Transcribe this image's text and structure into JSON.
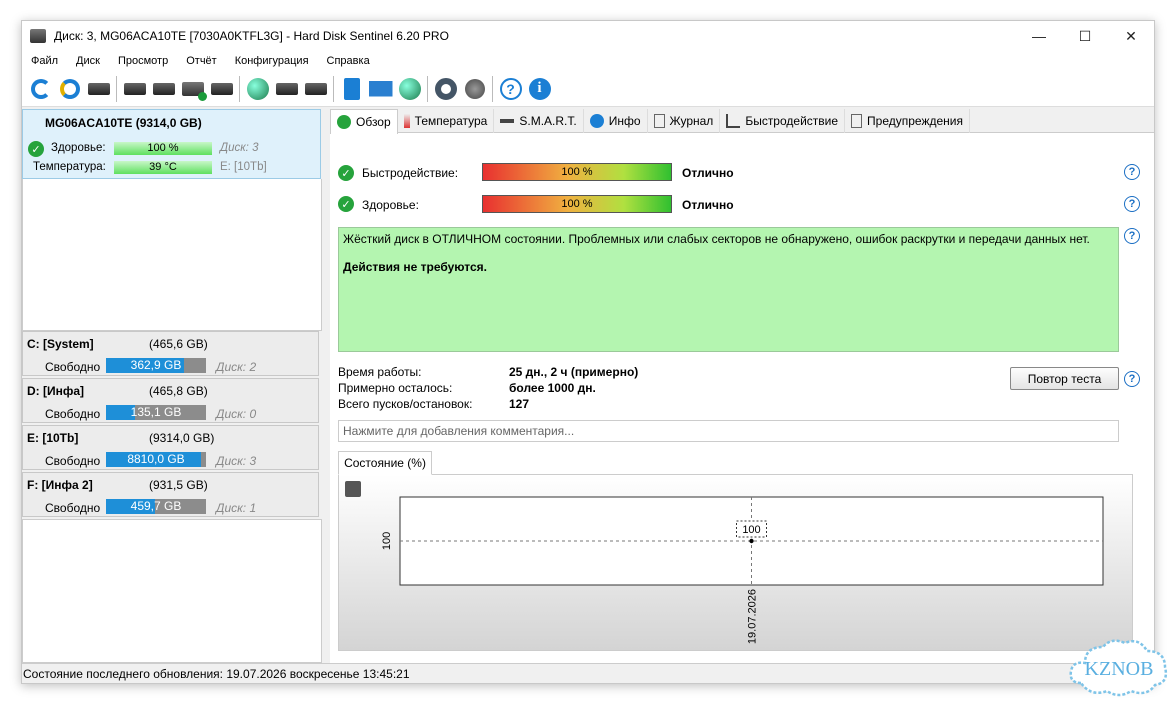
{
  "window": {
    "title": "Диск: 3, MG06ACA10TE [7030A0KTFL3G]  -  Hard Disk Sentinel 6.20 PRO",
    "controls": {
      "minimize": "—",
      "maximize": "☐",
      "close": "✕"
    }
  },
  "menu": [
    "Файл",
    "Диск",
    "Просмотр",
    "Отчёт",
    "Конфигурация",
    "Справка"
  ],
  "disk": {
    "name": "MG06ACA10TE (9314,0 GB)",
    "health_label": "Здоровье:",
    "health_value": "100 %",
    "health_percent": 100,
    "disk_ref": "Диск: 3",
    "temp_label": "Температура:",
    "temp_value": "39 °C",
    "volume_ref": "E: [10Tb]"
  },
  "volumes": [
    {
      "name": "C: [System]",
      "size": "(465,6 GB)",
      "free_label": "Свободно",
      "free": "362,9 GB",
      "free_fraction": 0.78,
      "disk": "Диск: 2"
    },
    {
      "name": "D: [Инфа]",
      "size": "(465,8 GB)",
      "free_label": "Свободно",
      "free": "135,1 GB",
      "free_fraction": 0.29,
      "disk": "Диск: 0"
    },
    {
      "name": "E: [10Tb]",
      "size": "(9314,0 GB)",
      "free_label": "Свободно",
      "free": "8810,0 GB",
      "free_fraction": 0.95,
      "disk": "Диск: 3"
    },
    {
      "name": "F: [Инфа 2]",
      "size": "(931,5 GB)",
      "free_label": "Свободно",
      "free": "459,7 GB",
      "free_fraction": 0.49,
      "disk": "Диск: 1"
    }
  ],
  "tabs": [
    "Обзор",
    "Температура",
    "S.M.A.R.T.",
    "Инфо",
    "Журнал",
    "Быстродействие",
    "Предупреждения"
  ],
  "overview": {
    "performance_label": "Быстродействие:",
    "performance_value": "100 %",
    "performance_percent": 100,
    "performance_status": "Отлично",
    "health_label": "Здоровье:",
    "health_value": "100 %",
    "health_percent": 100,
    "health_status": "Отлично",
    "message": "Жёсткий диск в ОТЛИЧНОМ состоянии. Проблемных или слабых секторов не обнаружено, ошибок раскрутки и передачи данных нет.",
    "action": "Действия не требуются.",
    "uptime_label": "Время работы:",
    "uptime_value": "25 дн., 2 ч (примерно)",
    "remaining_label": "Примерно осталось:",
    "remaining_value": "более 1000 дн.",
    "starts_label": "Всего пусков/остановок:",
    "starts_value": "127",
    "retest_button": "Повтор теста",
    "comment_placeholder": "Нажмите для добавления комментария...",
    "help": "?"
  },
  "chart_tab": "Состояние (%)",
  "chart_data": {
    "type": "line",
    "x": [
      "19.07.2026"
    ],
    "series": [
      {
        "values": [
          100
        ]
      }
    ],
    "ytick": "100",
    "point_label": "100"
  },
  "statusbar": "Состояние последнего обновления: 19.07.2026 воскресенье 13:45:21",
  "watermark": "KZNOB"
}
